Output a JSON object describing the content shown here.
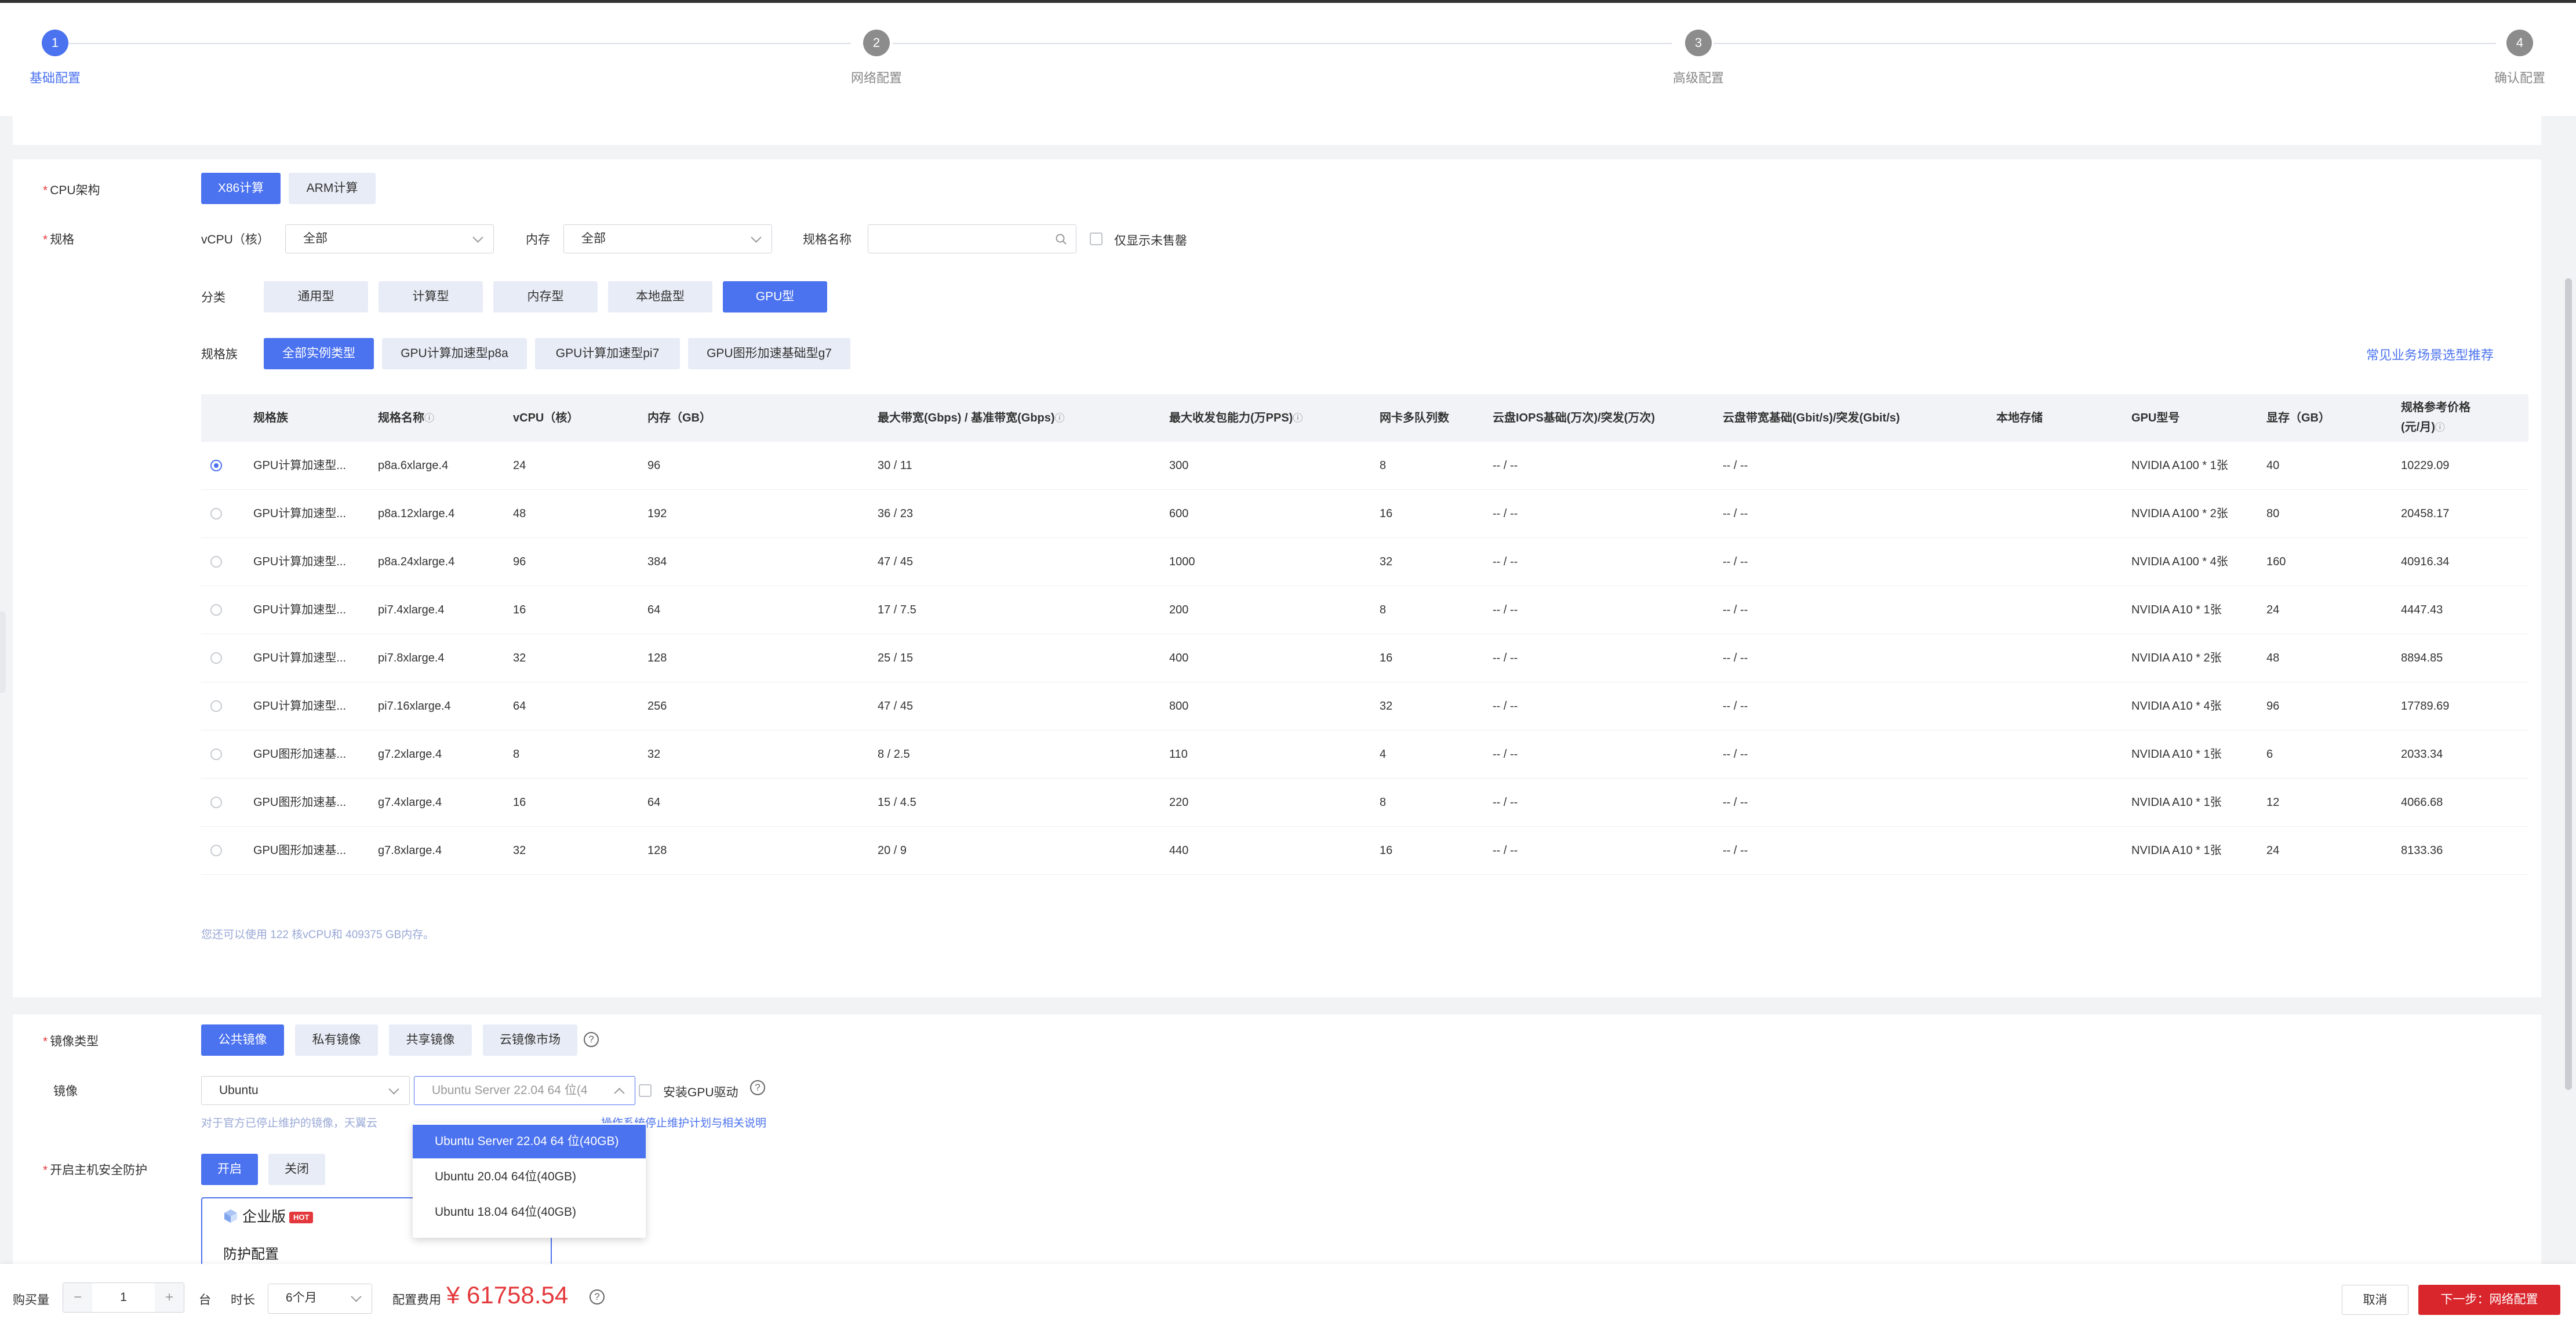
{
  "steps": [
    {
      "num": "1",
      "label": "基础配置"
    },
    {
      "num": "2",
      "label": "网络配置"
    },
    {
      "num": "3",
      "label": "高级配置"
    },
    {
      "num": "4",
      "label": "确认配置"
    }
  ],
  "cpu_arch": {
    "label": "CPU架构",
    "options": [
      "X86计算",
      "ARM计算"
    ],
    "selected": "X86计算"
  },
  "spec": {
    "label": "规格",
    "vcpu_label": "vCPU（核）",
    "vcpu_value": "全部",
    "mem_label": "内存",
    "mem_value": "全部",
    "name_label": "规格名称",
    "name_value": "",
    "search_icon": "search-icon",
    "unsold_label": "仅显示未售罄",
    "category_label": "分类",
    "categories": [
      "通用型",
      "计算型",
      "内存型",
      "本地盘型",
      "GPU型"
    ],
    "category_selected": "GPU型",
    "family_label": "规格族",
    "families": [
      "全部实例类型",
      "GPU计算加速型p8a",
      "GPU计算加速型pi7",
      "GPU图形加速基础型g7"
    ],
    "family_selected": "全部实例类型",
    "recommend_link": "常见业务场景选型推荐"
  },
  "table": {
    "headers": {
      "family": "规格族",
      "name": "规格名称",
      "vcpu": "vCPU（核）",
      "mem": "内存（GB）",
      "bandwidth": "最大带宽(Gbps) / 基准带宽(Gbps)",
      "pps": "最大收发包能力(万PPS)",
      "queues": "网卡多队列数",
      "iops": "云盘IOPS基础(万次)/突发(万次)",
      "disk_bw": "云盘带宽基础(Gbit/s)/突发(Gbit/s)",
      "local": "本地存储",
      "gpu": "GPU型号",
      "vmem": "显存（GB）",
      "price_line1": "规格参考价格",
      "price_line2": "(元/月)"
    },
    "rows": [
      {
        "family": "GPU计算加速型...",
        "name": "p8a.6xlarge.4",
        "vcpu": "24",
        "mem": "96",
        "bandwidth": "30 / 11",
        "pps": "300",
        "queues": "8",
        "iops": "-- / --",
        "disk_bw": "-- / --",
        "local": "",
        "gpu": "NVIDIA A100 * 1张",
        "vmem": "40",
        "price": "10229.09"
      },
      {
        "family": "GPU计算加速型...",
        "name": "p8a.12xlarge.4",
        "vcpu": "48",
        "mem": "192",
        "bandwidth": "36 / 23",
        "pps": "600",
        "queues": "16",
        "iops": "-- / --",
        "disk_bw": "-- / --",
        "local": "",
        "gpu": "NVIDIA A100 * 2张",
        "vmem": "80",
        "price": "20458.17"
      },
      {
        "family": "GPU计算加速型...",
        "name": "p8a.24xlarge.4",
        "vcpu": "96",
        "mem": "384",
        "bandwidth": "47 / 45",
        "pps": "1000",
        "queues": "32",
        "iops": "-- / --",
        "disk_bw": "-- / --",
        "local": "",
        "gpu": "NVIDIA A100 * 4张",
        "vmem": "160",
        "price": "40916.34"
      },
      {
        "family": "GPU计算加速型...",
        "name": "pi7.4xlarge.4",
        "vcpu": "16",
        "mem": "64",
        "bandwidth": "17 / 7.5",
        "pps": "200",
        "queues": "8",
        "iops": "-- / --",
        "disk_bw": "-- / --",
        "local": "",
        "gpu": "NVIDIA A10 * 1张",
        "vmem": "24",
        "price": "4447.43"
      },
      {
        "family": "GPU计算加速型...",
        "name": "pi7.8xlarge.4",
        "vcpu": "32",
        "mem": "128",
        "bandwidth": "25 / 15",
        "pps": "400",
        "queues": "16",
        "iops": "-- / --",
        "disk_bw": "-- / --",
        "local": "",
        "gpu": "NVIDIA A10 * 2张",
        "vmem": "48",
        "price": "8894.85"
      },
      {
        "family": "GPU计算加速型...",
        "name": "pi7.16xlarge.4",
        "vcpu": "64",
        "mem": "256",
        "bandwidth": "47 / 45",
        "pps": "800",
        "queues": "32",
        "iops": "-- / --",
        "disk_bw": "-- / --",
        "local": "",
        "gpu": "NVIDIA A10 * 4张",
        "vmem": "96",
        "price": "17789.69"
      },
      {
        "family": "GPU图形加速基...",
        "name": "g7.2xlarge.4",
        "vcpu": "8",
        "mem": "32",
        "bandwidth": "8 / 2.5",
        "pps": "110",
        "queues": "4",
        "iops": "-- / --",
        "disk_bw": "-- / --",
        "local": "",
        "gpu": "NVIDIA A10 * 1张",
        "vmem": "6",
        "price": "2033.34"
      },
      {
        "family": "GPU图形加速基...",
        "name": "g7.4xlarge.4",
        "vcpu": "16",
        "mem": "64",
        "bandwidth": "15 / 4.5",
        "pps": "220",
        "queues": "8",
        "iops": "-- / --",
        "disk_bw": "-- / --",
        "local": "",
        "gpu": "NVIDIA A10 * 1张",
        "vmem": "12",
        "price": "4066.68"
      },
      {
        "family": "GPU图形加速基...",
        "name": "g7.8xlarge.4",
        "vcpu": "32",
        "mem": "128",
        "bandwidth": "20 / 9",
        "pps": "440",
        "queues": "16",
        "iops": "-- / --",
        "disk_bw": "-- / --",
        "local": "",
        "gpu": "NVIDIA A10 * 1张",
        "vmem": "24",
        "price": "8133.36"
      }
    ],
    "selected_row": 0,
    "quota_note": "您还可以使用 122 核vCPU和 409375 GB内存。"
  },
  "image": {
    "type_label": "镜像类型",
    "types": [
      "公共镜像",
      "私有镜像",
      "共享镜像",
      "云镜像市场"
    ],
    "type_selected": "公共镜像",
    "label": "镜像",
    "os_value": "Ubuntu",
    "version_value": "Ubuntu Server 22.04 64 位(4",
    "gpu_driver_label": "安装GPU驱动",
    "note_prefix": "对于官方已停止维护的镜像，天翼云",
    "note_link": "操作系统停止维护计划与相关说明",
    "dropdown_options": [
      "Ubuntu Server 22.04 64 位(40GB)",
      "Ubuntu 20.04 64位(40GB)",
      "Ubuntu 18.04 64位(40GB)"
    ],
    "dropdown_selected": 0
  },
  "security": {
    "label": "开启主机安全防护",
    "options": [
      "开启",
      "关闭"
    ],
    "selected": "开启",
    "edition_title": "企业版",
    "edition_badge": "HOT",
    "edition_sub": "防护配置"
  },
  "footer": {
    "qty_label": "购买量",
    "qty_value": "1",
    "qty_unit": "台",
    "duration_label": "时长",
    "duration_value": "6个月",
    "fee_label": "配置费用",
    "fee_currency": "¥",
    "fee_value": "61758.54",
    "cancel_label": "取消",
    "next_label": "下一步：网络配置"
  },
  "colors": {
    "accent": "#4b72ef",
    "price_red": "#e4393c",
    "next_button": "#d9262c"
  }
}
